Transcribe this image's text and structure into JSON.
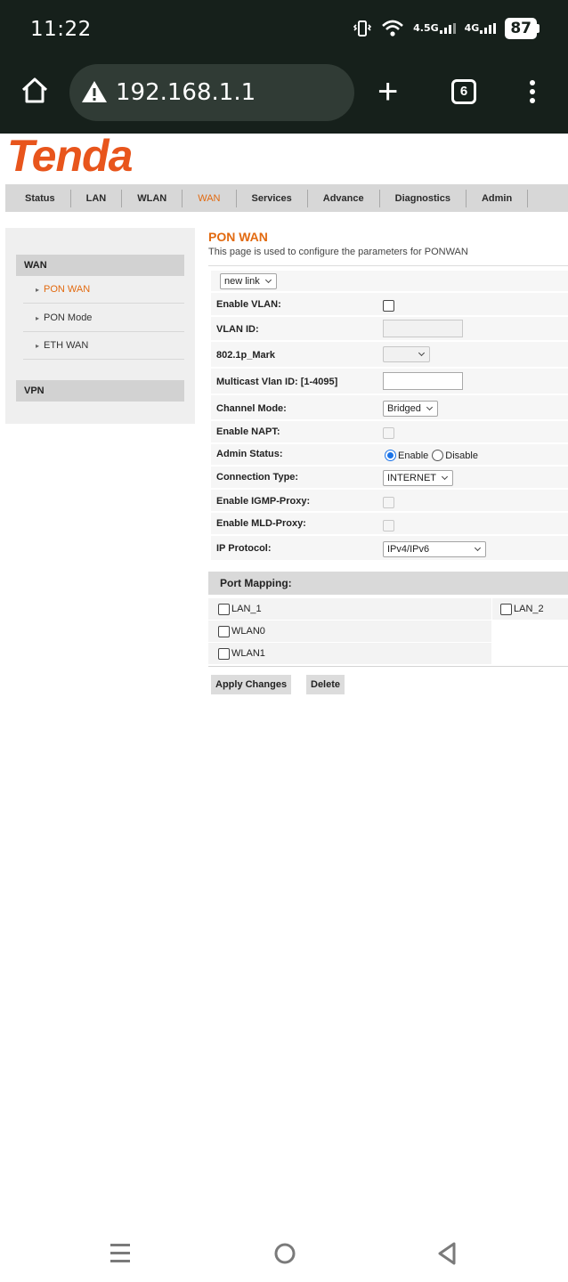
{
  "status_bar": {
    "time": "11:22",
    "network_1": "4.5G",
    "network_2": "4G",
    "battery": "87"
  },
  "browser": {
    "url": "192.168.1.1",
    "tab_count": "6",
    "icons": [
      "home-icon",
      "warning-icon",
      "plus-icon",
      "tabs-icon",
      "more-vert-icon"
    ]
  },
  "router": {
    "brand": "Tenda",
    "brand_color": "#e8551c",
    "accent_color": "#e26a10",
    "nav": [
      "Status",
      "LAN",
      "WLAN",
      "WAN",
      "Services",
      "Advance",
      "Diagnostics",
      "Admin"
    ],
    "nav_active": "WAN",
    "sidebar": {
      "section1": "WAN",
      "items": [
        "PON WAN",
        "PON Mode",
        "ETH WAN"
      ],
      "active_item": "PON WAN",
      "section2": "VPN"
    },
    "page_title": "PON WAN",
    "page_desc": "This page is used to configure the parameters for PONWAN",
    "link_select": "new link",
    "form": {
      "enable_vlan": "Enable VLAN:",
      "vlan_id": "VLAN ID:",
      "mark": "802.1p_Mark",
      "multicast": "Multicast Vlan ID: [1-4095]",
      "channel_mode": "Channel Mode:",
      "channel_mode_value": "Bridged",
      "enable_napt": "Enable NAPT:",
      "admin_status": "Admin Status:",
      "admin_enable": "Enable",
      "admin_disable": "Disable",
      "connection_type": "Connection Type:",
      "connection_type_value": "INTERNET",
      "igmp": "Enable IGMP-Proxy:",
      "mld": "Enable MLD-Proxy:",
      "ip_protocol": "IP Protocol:",
      "ip_protocol_value": "IPv4/IPv6"
    },
    "port_mapping": {
      "title": "Port Mapping:",
      "ports": [
        "LAN_1",
        "LAN_2",
        "WLAN0",
        "WLAN1"
      ]
    },
    "buttons": {
      "apply": "Apply Changes",
      "delete": "Delete"
    }
  }
}
